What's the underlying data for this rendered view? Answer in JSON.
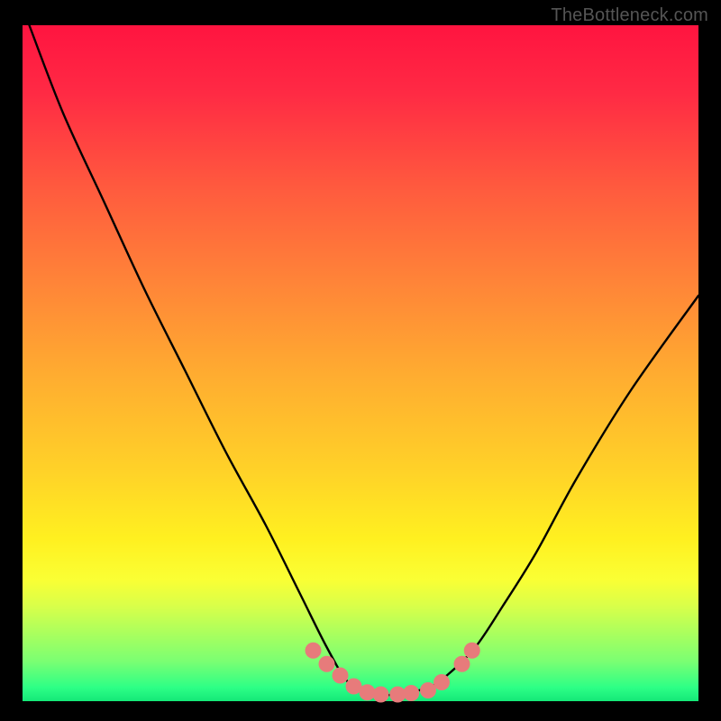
{
  "watermark": "TheBottleneck.com",
  "chart_data": {
    "type": "line",
    "title": "",
    "xlabel": "",
    "ylabel": "",
    "xlim": [
      0,
      1
    ],
    "ylim": [
      0,
      1
    ],
    "series": [
      {
        "name": "curve",
        "x": [
          0.01,
          0.06,
          0.12,
          0.18,
          0.24,
          0.3,
          0.36,
          0.41,
          0.45,
          0.48,
          0.51,
          0.55,
          0.6,
          0.63,
          0.67,
          0.71,
          0.76,
          0.82,
          0.9,
          1.0
        ],
        "values": [
          1.0,
          0.87,
          0.74,
          0.61,
          0.49,
          0.37,
          0.26,
          0.16,
          0.08,
          0.03,
          0.01,
          0.01,
          0.02,
          0.04,
          0.08,
          0.14,
          0.22,
          0.33,
          0.46,
          0.6
        ]
      }
    ],
    "markers": {
      "color": "#e77b7b",
      "radius_norm": 0.012,
      "points": [
        {
          "x": 0.43,
          "y": 0.075
        },
        {
          "x": 0.45,
          "y": 0.055
        },
        {
          "x": 0.47,
          "y": 0.038
        },
        {
          "x": 0.49,
          "y": 0.022
        },
        {
          "x": 0.51,
          "y": 0.013
        },
        {
          "x": 0.53,
          "y": 0.01
        },
        {
          "x": 0.555,
          "y": 0.01
        },
        {
          "x": 0.575,
          "y": 0.012
        },
        {
          "x": 0.6,
          "y": 0.016
        },
        {
          "x": 0.62,
          "y": 0.028
        },
        {
          "x": 0.65,
          "y": 0.055
        },
        {
          "x": 0.665,
          "y": 0.075
        }
      ]
    },
    "gradient_stops": [
      {
        "pos": 0.0,
        "color": "#ff1440"
      },
      {
        "pos": 0.5,
        "color": "#ffad30"
      },
      {
        "pos": 0.8,
        "color": "#fff020"
      },
      {
        "pos": 1.0,
        "color": "#14e878"
      }
    ]
  }
}
